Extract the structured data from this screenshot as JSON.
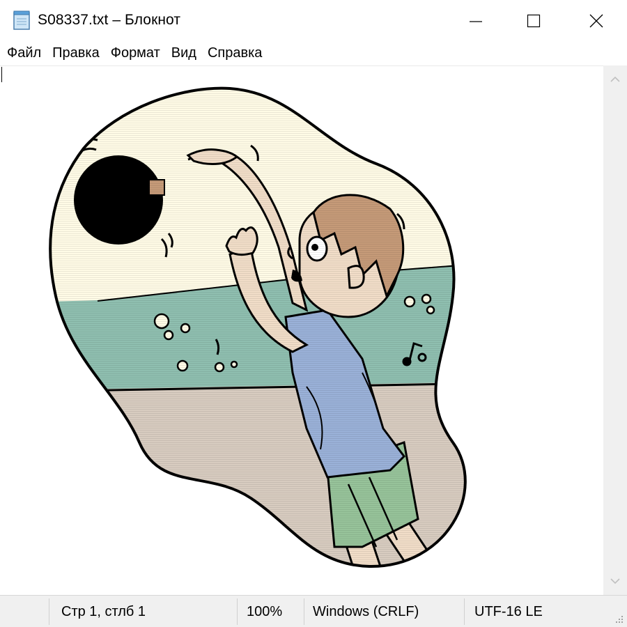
{
  "window": {
    "title": "S08337.txt – Блокнот",
    "icon": "notepad-icon",
    "controls": [
      "minimize-icon",
      "maximize-icon",
      "close-icon"
    ]
  },
  "menu": {
    "items": [
      "Файл",
      "Правка",
      "Формат",
      "Вид",
      "Справка"
    ]
  },
  "editor": {
    "content_kind": "ascii-art illustration",
    "content_description": "cartoon of a boy with brown hair in a blue shirt and green shorts reaching up toward a black ball, on a pale sky / teal water / beige ground background",
    "colors": {
      "sky": "#fffbe6",
      "water": "#8fbfb0",
      "ground": "#d8ccc0",
      "skin": "#f1ddc8",
      "hair": "#c59a78",
      "shirt": "#9ab1d8",
      "shorts": "#97c39a",
      "outline": "#000000"
    }
  },
  "scrollbar": {
    "up": "chevron-up-icon",
    "down": "chevron-down-icon"
  },
  "status": {
    "position": "Стр 1, стлб 1",
    "zoom": "100%",
    "line_ending": "Windows (CRLF)",
    "encoding": "UTF-16 LE"
  }
}
